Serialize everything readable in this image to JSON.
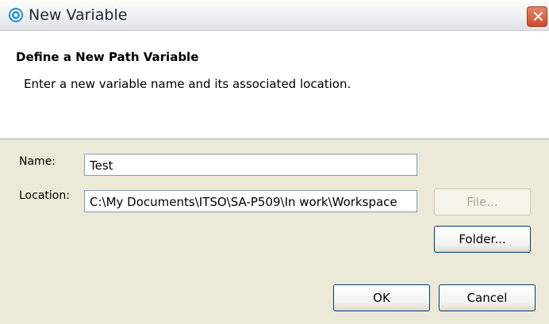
{
  "window": {
    "title": "New Variable"
  },
  "header": {
    "title": "Define a New Path Variable",
    "message": "Enter a new variable name and its associated location."
  },
  "form": {
    "name_label": "Name:",
    "name_value": "Test",
    "location_label": "Location:",
    "location_value": "C:\\My Documents\\ITSO\\SA-P509\\In work\\Workspace"
  },
  "buttons": {
    "file": "File...",
    "folder": "Folder...",
    "ok": "OK",
    "cancel": "Cancel"
  },
  "icons": {
    "app": "eclipse-swirl-icon",
    "close": "close-icon"
  },
  "colors": {
    "close_button": "#d04a26",
    "field_border": "#7f9db9",
    "dialog_bg": "#ece9d8"
  }
}
